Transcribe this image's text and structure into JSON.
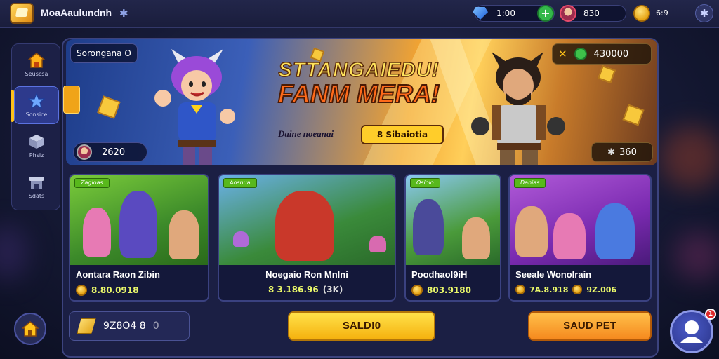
{
  "app": {
    "title": "MoaAaulundnh"
  },
  "topbar": {
    "gems": "1:00",
    "avatar_value": "830",
    "coin_value": "6:9 ",
    "coin_unit": "6:9",
    "plus_label": "+"
  },
  "sidebar": {
    "items": [
      {
        "label": "Seuscsa"
      },
      {
        "label": "Sonsice"
      },
      {
        "label": "Phsiz"
      },
      {
        "label": "Sdats"
      }
    ]
  },
  "banner": {
    "tag": "Sorongana O",
    "headline_1": "STTANGAIEDU!",
    "headline_2": "FANM MERA!",
    "subline": "Daine noeanai",
    "button": "8 Sibaiotia",
    "score": "2620",
    "reward": "430000",
    "count": "360"
  },
  "cards": [
    {
      "badge": "Zagioas",
      "title": "Aontara Raon Zibin",
      "price": "8.80.0918"
    },
    {
      "badge": "Aosnua",
      "title": "Noegaio Ron Mnlni",
      "price": "8 3.186.96",
      "extra": "(3K)"
    },
    {
      "badge": "Osiolo",
      "title": "Poodhaol9iH",
      "price": "803.9180"
    },
    {
      "badge": "Danias",
      "title": "Seeale Wonolrain",
      "price": "7A.8.918",
      "price2": "9Z.006"
    }
  ],
  "footer": {
    "currency": "9Z8O4 8",
    "currency_unit": "0",
    "primary_button": "SALD!0",
    "secondary_button": "SAUD PET",
    "notification_count": "1"
  },
  "colors": {
    "accent": "#ffc21a",
    "panel": "#1b1f44",
    "green": "#58b81c"
  }
}
